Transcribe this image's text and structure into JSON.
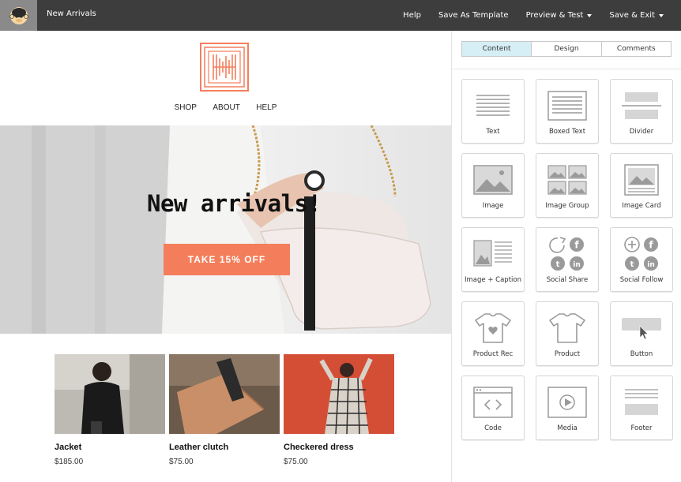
{
  "topbar": {
    "title": "New Arrivals",
    "menu": [
      {
        "label": "Help",
        "dropdown": false
      },
      {
        "label": "Save As Template",
        "dropdown": false
      },
      {
        "label": "Preview & Test",
        "dropdown": true
      },
      {
        "label": "Save & Exit",
        "dropdown": true
      }
    ]
  },
  "email": {
    "nav": [
      "SHOP",
      "ABOUT",
      "HELP"
    ],
    "hero_title": "New arrivals!",
    "hero_cta": "TAKE 15% OFF",
    "products": [
      {
        "name": "Jacket",
        "price": "$185.00"
      },
      {
        "name": "Leather clutch",
        "price": "$75.00"
      },
      {
        "name": "Checkered dress",
        "price": "$75.00"
      }
    ]
  },
  "sidebar": {
    "tabs": [
      {
        "label": "Content",
        "active": true
      },
      {
        "label": "Design",
        "active": false
      },
      {
        "label": "Comments",
        "active": false
      }
    ],
    "blocks": [
      {
        "label": "Text",
        "icon": "text-icon"
      },
      {
        "label": "Boxed Text",
        "icon": "boxed-text-icon"
      },
      {
        "label": "Divider",
        "icon": "divider-icon"
      },
      {
        "label": "Image",
        "icon": "image-icon"
      },
      {
        "label": "Image Group",
        "icon": "image-group-icon"
      },
      {
        "label": "Image Card",
        "icon": "image-card-icon"
      },
      {
        "label": "Image + Caption",
        "icon": "image-caption-icon"
      },
      {
        "label": "Social Share",
        "icon": "social-share-icon"
      },
      {
        "label": "Social Follow",
        "icon": "social-follow-icon"
      },
      {
        "label": "Product Rec",
        "icon": "product-rec-icon"
      },
      {
        "label": "Product",
        "icon": "product-icon"
      },
      {
        "label": "Button",
        "icon": "button-icon"
      },
      {
        "label": "Code",
        "icon": "code-icon"
      },
      {
        "label": "Media",
        "icon": "media-icon"
      },
      {
        "label": "Footer",
        "icon": "footer-icon"
      }
    ]
  },
  "colors": {
    "topbar": "#3d3d3d",
    "accent": "#f47e5c",
    "active_tab": "#d6eef5",
    "icon_gray": "#9a9a9a"
  }
}
